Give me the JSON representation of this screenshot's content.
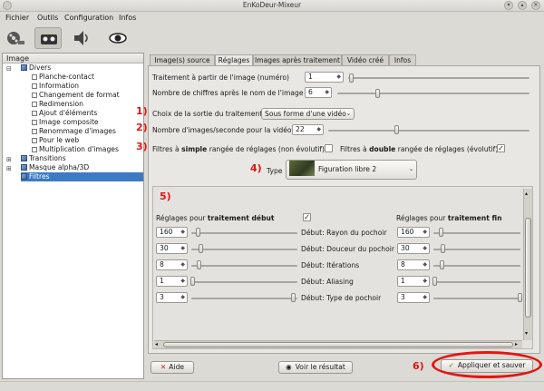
{
  "window": {
    "title": "EnKoDeur-Mixeur"
  },
  "menu": [
    "Fichier",
    "Outils",
    "Configuration",
    "Infos"
  ],
  "toolbar": {
    "icons": [
      "film-reel-icon",
      "tape-icon",
      "speaker-icon",
      "eye-icon"
    ]
  },
  "sidebar": {
    "header": "Image",
    "items": [
      {
        "label": "Divers",
        "level": 0,
        "expanded": true
      },
      {
        "label": "Planche-contact",
        "level": 1
      },
      {
        "label": "Information",
        "level": 1
      },
      {
        "label": "Changement de format",
        "level": 1
      },
      {
        "label": "Redimension",
        "level": 1
      },
      {
        "label": "Ajout d'éléments",
        "level": 1
      },
      {
        "label": "Image composite",
        "level": 1
      },
      {
        "label": "Renommage d'images",
        "level": 1
      },
      {
        "label": "Pour le web",
        "level": 1
      },
      {
        "label": "Multiplication d'images",
        "level": 1
      },
      {
        "label": "Transitions",
        "level": 0,
        "expanded": false
      },
      {
        "label": "Masque alpha/3D",
        "level": 0,
        "expanded": false
      },
      {
        "label": "Filtres",
        "level": 0,
        "selected": true
      }
    ]
  },
  "tabs": [
    "Image(s) source",
    "Réglages",
    "Images après traitement",
    "Vidéo créé",
    "Infos"
  ],
  "active_tab": "Réglages",
  "settings": {
    "start_label": "Traitement à partir de l'image (numéro)",
    "start_value": "1",
    "digits_label": "Nombre de chiffres après le nom de l'image",
    "digits_value": "6",
    "output_label": "Choix de la sortie du traitement",
    "output_value": "Sous forme d'une vidéo",
    "fps_label": "Nombre d'images/seconde pour la vidéo",
    "fps_value": "22",
    "simple_pre": "Filtres à ",
    "simple_bold": "simple",
    "simple_post": " rangée de réglages (non évolutif)",
    "double_pre": "Filtres à ",
    "double_bold": "double",
    "double_post": " rangée de réglages (évolutif)",
    "type_label": "Type",
    "type_value": "Figuration libre 2"
  },
  "annotations": [
    "1)",
    "2)",
    "3)",
    "4)",
    "5)",
    "6)"
  ],
  "params": {
    "start_header_pre": "Réglages pour ",
    "start_header_bold": "traitement début",
    "end_header_pre": "Réglages pour ",
    "end_header_bold": "traitement fin",
    "rows": [
      {
        "left": "160",
        "label": "Début: Rayon du pochoir",
        "right": "160"
      },
      {
        "left": "30",
        "label": "Début: Douceur du pochoir",
        "right": "30"
      },
      {
        "left": "8",
        "label": "Début: Itérations",
        "right": "8"
      },
      {
        "left": "1",
        "label": "Début: Aliasing",
        "right": "1"
      },
      {
        "left": "3",
        "label": "Début: Type de pochoir",
        "right": "3"
      }
    ]
  },
  "buttons": {
    "help": "Aide",
    "preview": "Voir le résultat",
    "apply": "Appliquer et sauver"
  },
  "colors": {
    "annotation": "#e41414",
    "selection": "#3d7ac4"
  }
}
